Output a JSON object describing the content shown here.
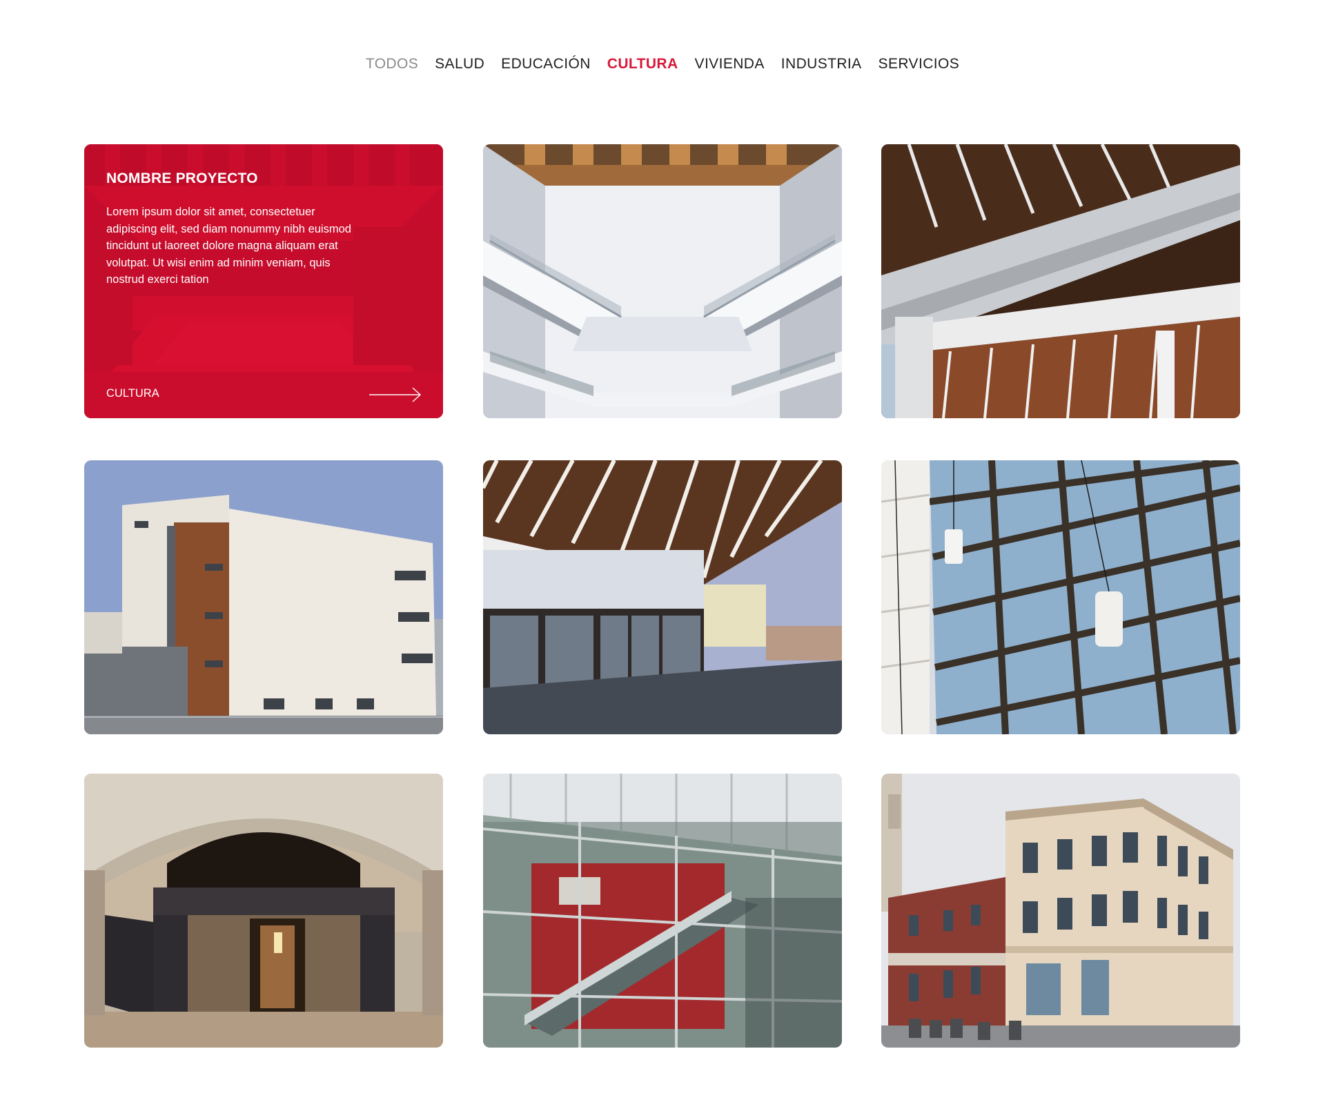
{
  "filters": [
    {
      "label": "TODOS",
      "state": "muted"
    },
    {
      "label": "SALUD",
      "state": "normal"
    },
    {
      "label": "EDUCACIÓN",
      "state": "normal"
    },
    {
      "label": "CULTURA",
      "state": "active"
    },
    {
      "label": "VIVIENDA",
      "state": "normal"
    },
    {
      "label": "INDUSTRIA",
      "state": "normal"
    },
    {
      "label": "SERVICIOS",
      "state": "normal"
    }
  ],
  "featured": {
    "title": "NOMBRE PROYECTO",
    "description": "Lorem ipsum dolor sit amet, consectetuer adipiscing elit, sed diam nonummy nibh euismod tincidunt ut laoreet dolore magna aliquam erat volutpat. Ut wisi enim ad minim veniam, quis nostrud exerci tation",
    "category": "CULTURA",
    "icon": "arrow-right-icon"
  },
  "colors": {
    "accent": "#d8183a",
    "text": "#1e1e1e",
    "muted": "#8a8a8a"
  }
}
